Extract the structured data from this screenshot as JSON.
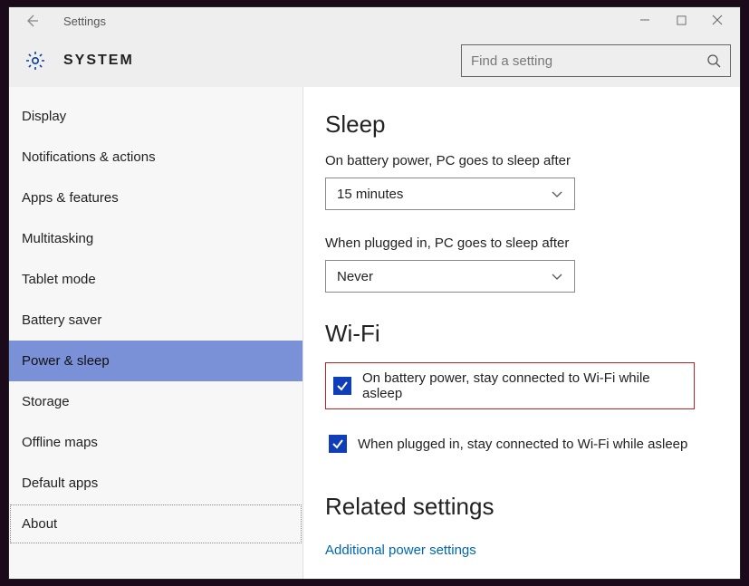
{
  "titlebar": {
    "app_name": "Settings"
  },
  "header": {
    "brand": "SYSTEM"
  },
  "search": {
    "placeholder": "Find a setting"
  },
  "sidebar": {
    "items": [
      {
        "label": "Display"
      },
      {
        "label": "Notifications & actions"
      },
      {
        "label": "Apps & features"
      },
      {
        "label": "Multitasking"
      },
      {
        "label": "Tablet mode"
      },
      {
        "label": "Battery saver"
      },
      {
        "label": "Power & sleep"
      },
      {
        "label": "Storage"
      },
      {
        "label": "Offline maps"
      },
      {
        "label": "Default apps"
      },
      {
        "label": "About"
      }
    ],
    "selected_index": 6
  },
  "content": {
    "sleep": {
      "heading": "Sleep",
      "battery_label": "On battery power, PC goes to sleep after",
      "battery_value": "15 minutes",
      "plugged_label": "When plugged in, PC goes to sleep after",
      "plugged_value": "Never"
    },
    "wifi": {
      "heading": "Wi-Fi",
      "cb1_label": "On battery power, stay connected to Wi-Fi while asleep",
      "cb2_label": "When plugged in, stay connected to Wi-Fi while asleep"
    },
    "related": {
      "heading": "Related settings",
      "link": "Additional power settings"
    }
  }
}
